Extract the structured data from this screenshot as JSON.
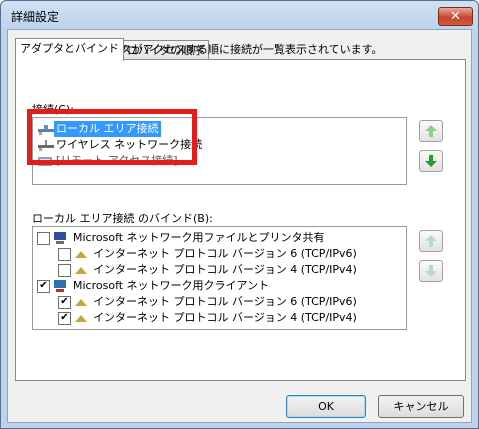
{
  "window": {
    "title": "詳細設定",
    "close_label": "✕"
  },
  "tabs": [
    {
      "label": "アダプタとバインド"
    },
    {
      "label": "プロバイダの順序"
    }
  ],
  "description": "ネットワーク サービスがアクセスする順に接続が一覧表示されています。",
  "connections": {
    "label": "接続(C):",
    "items": [
      {
        "label": "ローカル エリア接続",
        "icon": "network-adapter-icon"
      },
      {
        "label": "ワイヤレス ネットワーク接続",
        "icon": "wireless-adapter-icon"
      },
      {
        "label": "[リモート アクセス接続]",
        "icon": "remote-access-icon"
      }
    ]
  },
  "bindings": {
    "label": "ローカル エリア接続 のバインド(B):",
    "items": [
      {
        "label": "Microsoft ネットワーク用ファイルとプリンタ共有",
        "checked": false
      },
      {
        "label": "インターネット プロトコル バージョン 6 (TCP/IPv6)",
        "checked": false
      },
      {
        "label": "インターネット プロトコル バージョン 4 (TCP/IPv4)",
        "checked": false
      },
      {
        "label": "Microsoft ネットワーク用クライアント",
        "checked": true
      },
      {
        "label": "インターネット プロトコル バージョン 6 (TCP/IPv6)",
        "checked": true
      },
      {
        "label": "インターネット プロトコル バージョン 4 (TCP/IPv4)",
        "checked": true
      }
    ]
  },
  "buttons": {
    "ok": "OK",
    "cancel": "キャンセル",
    "check": "✔"
  },
  "colors": {
    "selection": "#3399ff",
    "arrow_up": "#8ecf8e",
    "arrow_down": "#2d9a2d",
    "highlight_box": "#e51c1c"
  }
}
